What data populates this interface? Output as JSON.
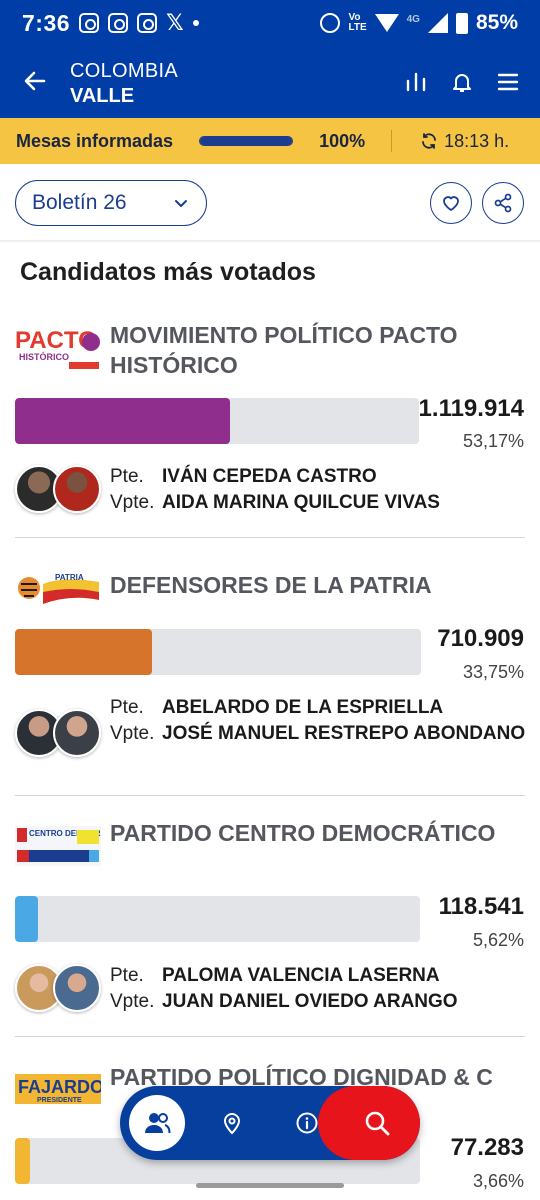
{
  "status_bar": {
    "time": "7:36",
    "volte_top": "Vo",
    "volte_bottom": "LTE",
    "network": "4G",
    "battery": "85%"
  },
  "header": {
    "country": "COLOMBIA",
    "region": "VALLE",
    "icons": [
      "back-arrow-icon",
      "chart-icon",
      "bell-icon",
      "menu-icon"
    ]
  },
  "mesas": {
    "label": "Mesas informadas",
    "progress": 1.0,
    "percent": "100%",
    "time": "18:13 h."
  },
  "boletin": {
    "label": "Boletín 26"
  },
  "section_title": "Candidatos más votados",
  "candidates": [
    {
      "party": "MOVIMIENTO POLÍTICO PACTO HISTÓRICO",
      "logo_text": "PACTO",
      "votes": "1.119.914",
      "percent": "53,17%",
      "share": 53.17,
      "color": "#8f2e8c",
      "pte_label": "Pte.",
      "pte": "IVÁN CEPEDA CASTRO",
      "vpte_label": "Vpte.",
      "vpte": "AIDA MARINA QUILCUE VIVAS"
    },
    {
      "party": "DEFENSORES DE LA PATRIA",
      "logo_text": "PATRIA",
      "votes": "710.909",
      "percent": "33,75%",
      "share": 33.75,
      "color": "#d6742c",
      "pte_label": "Pte.",
      "pte": "ABELARDO DE LA ESPRIELLA",
      "vpte_label": "Vpte.",
      "vpte": "JOSÉ MANUEL RESTREPO ABONDANO"
    },
    {
      "party": "PARTIDO CENTRO DEMOCRÁTICO",
      "logo_text": "CENTRO DEMOCRÁTICO",
      "votes": "118.541",
      "percent": "5,62%",
      "share": 5.62,
      "color": "#4aa9e4",
      "pte_label": "Pte.",
      "pte": "PALOMA VALENCIA LASERNA",
      "vpte_label": "Vpte.",
      "vpte": "JUAN DANIEL OVIEDO ARANGO"
    },
    {
      "party": "PARTIDO POLÍTICO DIGNIDAD & C",
      "logo_text": "FAJARDO",
      "logo_sub": "PRESIDENTE",
      "votes": "77.283",
      "percent": "3,66%",
      "share": 3.66,
      "color": "#f2b632"
    }
  ],
  "bottom_nav": {
    "items": [
      "candidates-icon",
      "location-icon",
      "info-icon",
      "search-icon"
    ]
  }
}
